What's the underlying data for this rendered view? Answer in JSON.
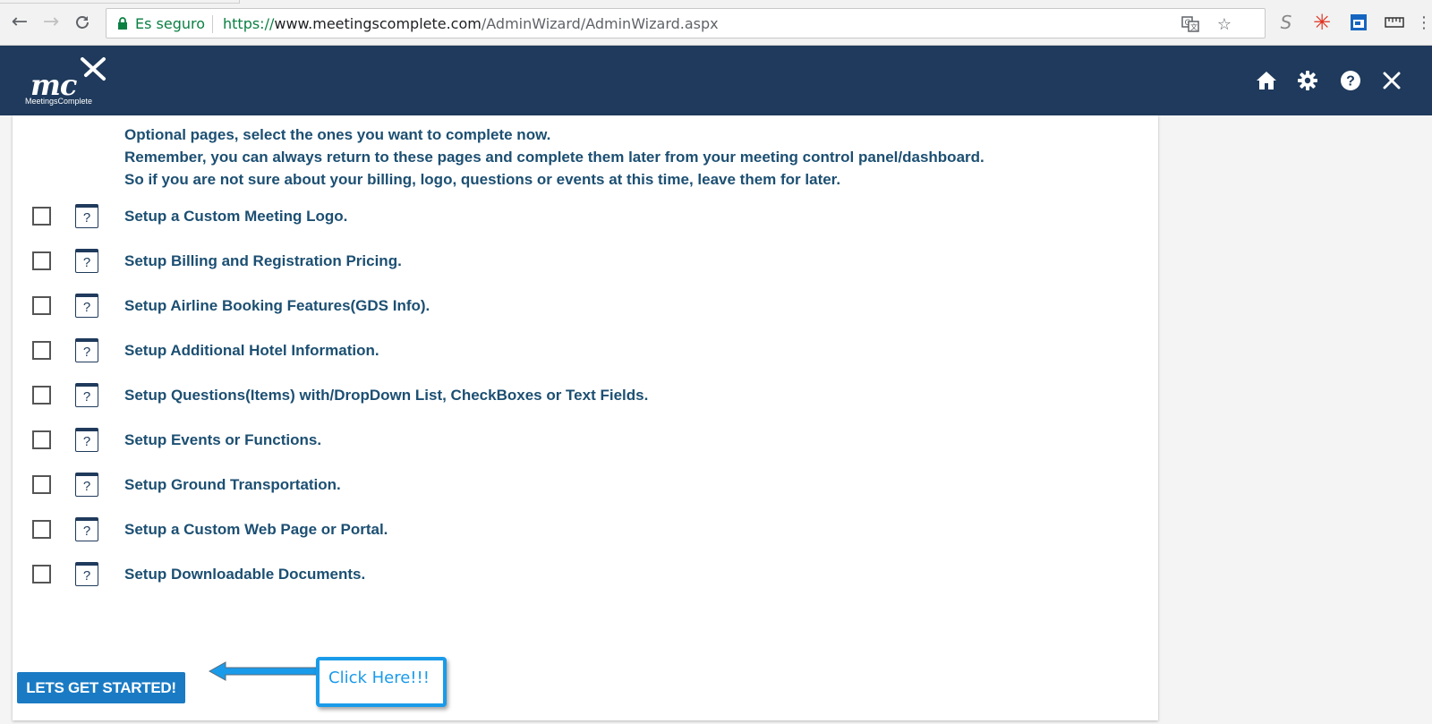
{
  "browser": {
    "secure_label": "Es seguro",
    "url_scheme": "https://",
    "url_host": "www.meetingscomplete.com",
    "url_path": "/AdminWizard/AdminWizard.aspx",
    "icons": [
      "back-icon",
      "forward-icon",
      "reload-icon",
      "lock-icon",
      "translate-icon",
      "bookmark-star-icon",
      "extension-s-icon",
      "extension-asterisk-icon",
      "extension-window-icon",
      "extension-ruler-icon",
      "menu-icon"
    ],
    "colors": {
      "secure": "#0b8043"
    }
  },
  "header": {
    "logo_text": "mc",
    "logo_subtext": "MeetingsComplete",
    "icons": [
      "home-icon",
      "gear-icon",
      "help-icon",
      "close-icon"
    ],
    "colors": {
      "background": "#1f3a5c"
    }
  },
  "intro": {
    "line1": "Optional pages, select the ones you want to complete now.",
    "line2": "Remember, you can always return to these pages and complete them later from your meeting control panel/dashboard.",
    "line3": "So if you are not sure about your billing, logo, questions or events at this time, leave them for later."
  },
  "options": [
    {
      "label": "Setup a Custom Meeting Logo.",
      "checked": false,
      "help": "?"
    },
    {
      "label": "Setup Billing and Registration Pricing.",
      "checked": false,
      "help": "?"
    },
    {
      "label": "Setup Airline Booking Features(GDS Info).",
      "checked": false,
      "help": "?"
    },
    {
      "label": "Setup Additional Hotel Information.",
      "checked": false,
      "help": "?"
    },
    {
      "label": "Setup Questions(Items) with/DropDown List, CheckBoxes or Text Fields.",
      "checked": false,
      "help": "?"
    },
    {
      "label": "Setup Events or Functions.",
      "checked": false,
      "help": "?"
    },
    {
      "label": "Setup Ground Transportation.",
      "checked": false,
      "help": "?"
    },
    {
      "label": "Setup a Custom Web Page or Portal.",
      "checked": false,
      "help": "?"
    },
    {
      "label": "Setup Downloadable Documents.",
      "checked": false,
      "help": "?"
    }
  ],
  "actions": {
    "start_label": "LETS GET STARTED!",
    "callout_text": "Click Here!!!",
    "colors": {
      "button": "#1a7bc4",
      "callout": "#1a9bea",
      "text": "#1c4f72"
    }
  }
}
